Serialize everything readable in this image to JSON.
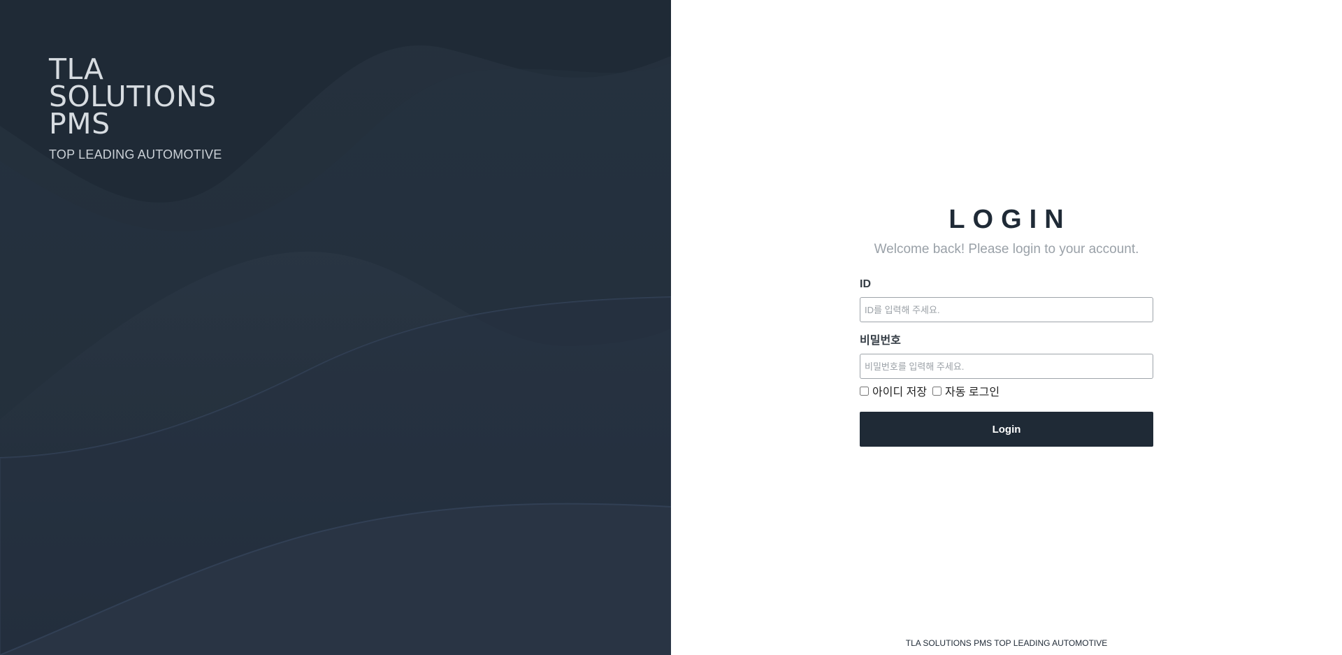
{
  "brand": {
    "title": "TLA\nSOLUTIONS\nPMS",
    "subtitle": "TOP LEADING AUTOMOTIVE"
  },
  "login": {
    "title": "LOGIN",
    "subtitle": "Welcome back! Please login to your account.",
    "id_label": "ID",
    "id_placeholder": "ID를 입력해 주세요.",
    "password_label": "비밀번호",
    "password_placeholder": "비밀번호를 입력해 주세요.",
    "remember_id_label": "아이디 저장",
    "auto_login_label": "자동 로그인",
    "button_label": "Login"
  },
  "footer": {
    "text": "TLA SOLUTIONS PMS TOP LEADING AUTOMOTIVE"
  },
  "colors": {
    "panel_bg": "#1f2a36",
    "accent": "#1f2a36",
    "subtitle_gray": "#9aa1a8"
  }
}
